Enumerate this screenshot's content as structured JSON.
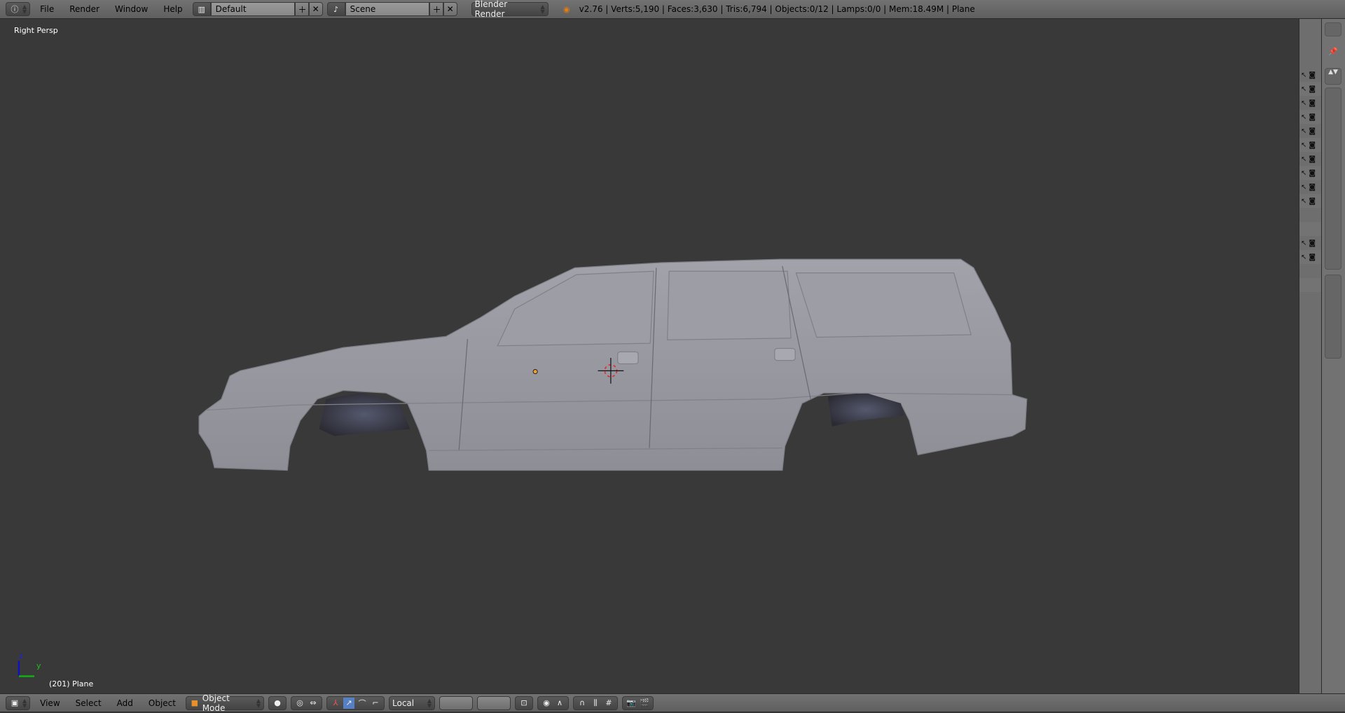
{
  "topbar": {
    "menus": [
      "File",
      "Render",
      "Window",
      "Help"
    ],
    "layout": "Default",
    "scene": "Scene",
    "engine": "Blender Render",
    "stats": "v2.76 | Verts:5,190 | Faces:3,630 | Tris:6,794 | Objects:0/12 | Lamps:0/0 | Mem:18.49M | Plane"
  },
  "viewport": {
    "view_name": "Right Persp",
    "object_info": "(201) Plane",
    "axis_z": "z",
    "axis_y": "y"
  },
  "bottombar": {
    "menus": [
      "View",
      "Select",
      "Add",
      "Object"
    ],
    "mode": "Object Mode",
    "orientation": "Local"
  },
  "colors": {
    "accent": "#5680c2",
    "header": "#6b6b6b",
    "viewport": "#393939",
    "mesh": "#9a9aa2"
  }
}
